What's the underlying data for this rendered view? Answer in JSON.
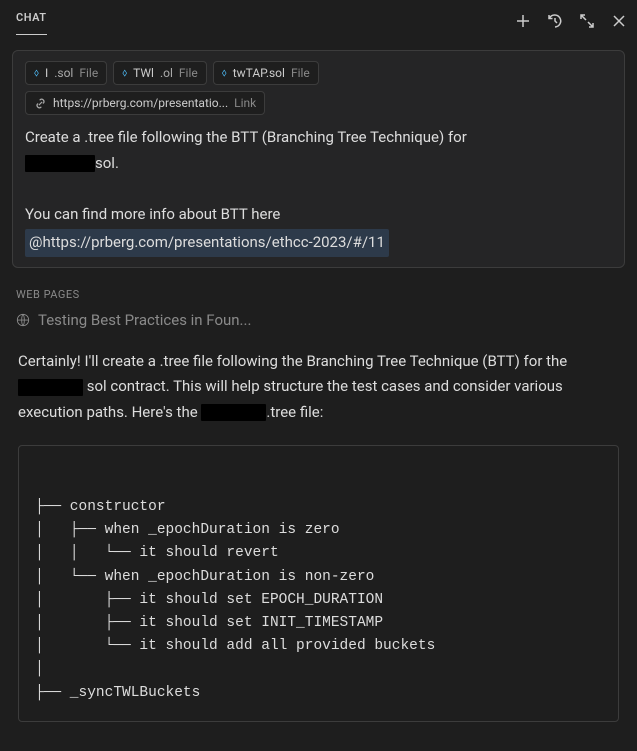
{
  "header": {
    "title": "CHAT"
  },
  "userMessage": {
    "fileChips": [
      {
        "name": "I",
        "ext": ".sol",
        "type": "File"
      },
      {
        "name": "TWl",
        "ext": ".ol",
        "type": "File"
      },
      {
        "name": "twTAP.sol",
        "ext": "",
        "type": "File"
      }
    ],
    "linkChip": {
      "url": "https://prberg.com/presentatio...",
      "type": "Link"
    },
    "line1": "Create a .tree file following the BTT (Branching Tree Technique) for ",
    "line1suffix": "sol.",
    "line2": "You can find more info about BTT here",
    "url": "@https://prberg.com/presentations/ethcc-2023/#/11"
  },
  "webPages": {
    "label": "WEB PAGES",
    "item": "Testing Best Practices in Foun..."
  },
  "assistantMessage": {
    "p1a": "Certainly! I'll create a .tree file following the Branching Tree Technique (BTT) for the ",
    "p1b": "sol contract. This will help structure the test cases and consider various execution paths. Here's the ",
    "p1c": ".tree file:"
  },
  "code": {
    "l1": "├── constructor",
    "l2": "│   ├── when _epochDuration is zero",
    "l3": "│   │   └── it should revert",
    "l4": "│   └── when _epochDuration is non-zero",
    "l5": "│       ├── it should set EPOCH_DURATION",
    "l6": "│       ├── it should set INIT_TIMESTAMP",
    "l7": "│       └── it should add all provided buckets",
    "l8": "│",
    "l9": "├── _syncTWLBuckets"
  }
}
